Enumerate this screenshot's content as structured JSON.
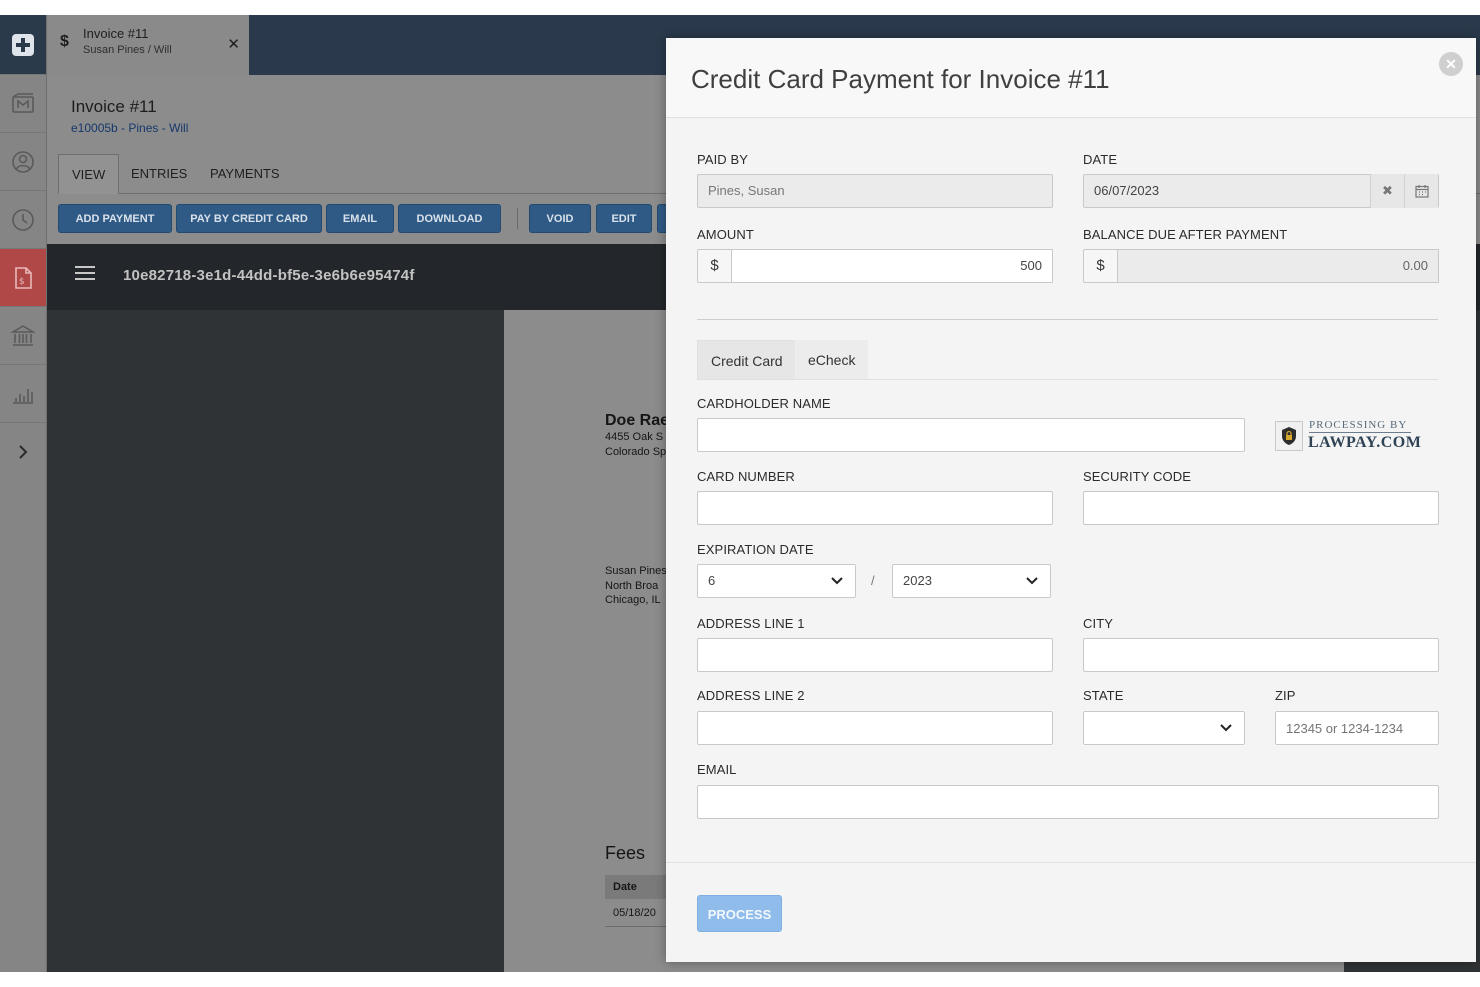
{
  "tab": {
    "currency_symbol": "$",
    "title": "Invoice #11",
    "subtitle": "Susan Pines / Will",
    "close": "✕"
  },
  "page": {
    "title": "Invoice #11",
    "subtitle": "e10005b - Pines - Will",
    "tabs": [
      "VIEW",
      "ENTRIES",
      "PAYMENTS"
    ],
    "active_tab": "VIEW"
  },
  "toolbar": {
    "buttons": [
      "ADD PAYMENT",
      "PAY BY CREDIT CARD",
      "EMAIL",
      "DOWNLOAD",
      "VOID",
      "EDIT"
    ]
  },
  "viewer": {
    "document_id": "10e82718-3e1d-44dd-bf5e-3e6b6e95474f"
  },
  "document": {
    "firm_name": "Doe Rae",
    "firm_address_1": "4455 Oak S",
    "firm_address_2": "Colorado Sp",
    "client_name": "Susan Pines",
    "client_address_1": "North Broa",
    "client_address_2": "Chicago, IL",
    "fees_heading": "Fees",
    "fees_col_date": "Date",
    "fees_row_date": "05/18/20"
  },
  "sidebar": {
    "icons": [
      "add-icon",
      "matters-icon",
      "contacts-icon",
      "time-icon",
      "invoices-icon",
      "bank-icon",
      "reports-icon",
      "expand-icon"
    ],
    "active": "invoices-icon",
    "active_color": "#b04848"
  },
  "modal": {
    "title": "Credit Card Payment for Invoice #11",
    "close": "✕",
    "paid_by_label": "PAID BY",
    "paid_by_value": "Pines, Susan",
    "date_label": "DATE",
    "date_value": "06/07/2023",
    "date_clear": "✖",
    "amount_label": "AMOUNT",
    "amount_currency": "$",
    "amount_value": "500",
    "balance_label": "BALANCE DUE AFTER PAYMENT",
    "balance_currency": "$",
    "balance_value": "0.00",
    "method_tabs": [
      "Credit Card",
      "eCheck"
    ],
    "active_method": "Credit Card",
    "cardholder_label": "CARDHOLDER NAME",
    "cardholder_value": "",
    "processing_by": "PROCESSING BY",
    "processor_brand": "LAWPAY.COM",
    "card_number_label": "CARD NUMBER",
    "card_number_value": "",
    "security_code_label": "SECURITY CODE",
    "security_code_value": "",
    "expiration_label": "EXPIRATION DATE",
    "expiration_month": "6",
    "expiration_separator": "/",
    "expiration_year": "2023",
    "address1_label": "ADDRESS LINE 1",
    "city_label": "CITY",
    "address2_label": "ADDRESS LINE 2",
    "state_label": "STATE",
    "state_value": "",
    "zip_label": "ZIP",
    "zip_placeholder": "12345 or 1234-1234",
    "email_label": "EMAIL",
    "process_label": "PROCESS",
    "process_color": "#8fbcea"
  }
}
